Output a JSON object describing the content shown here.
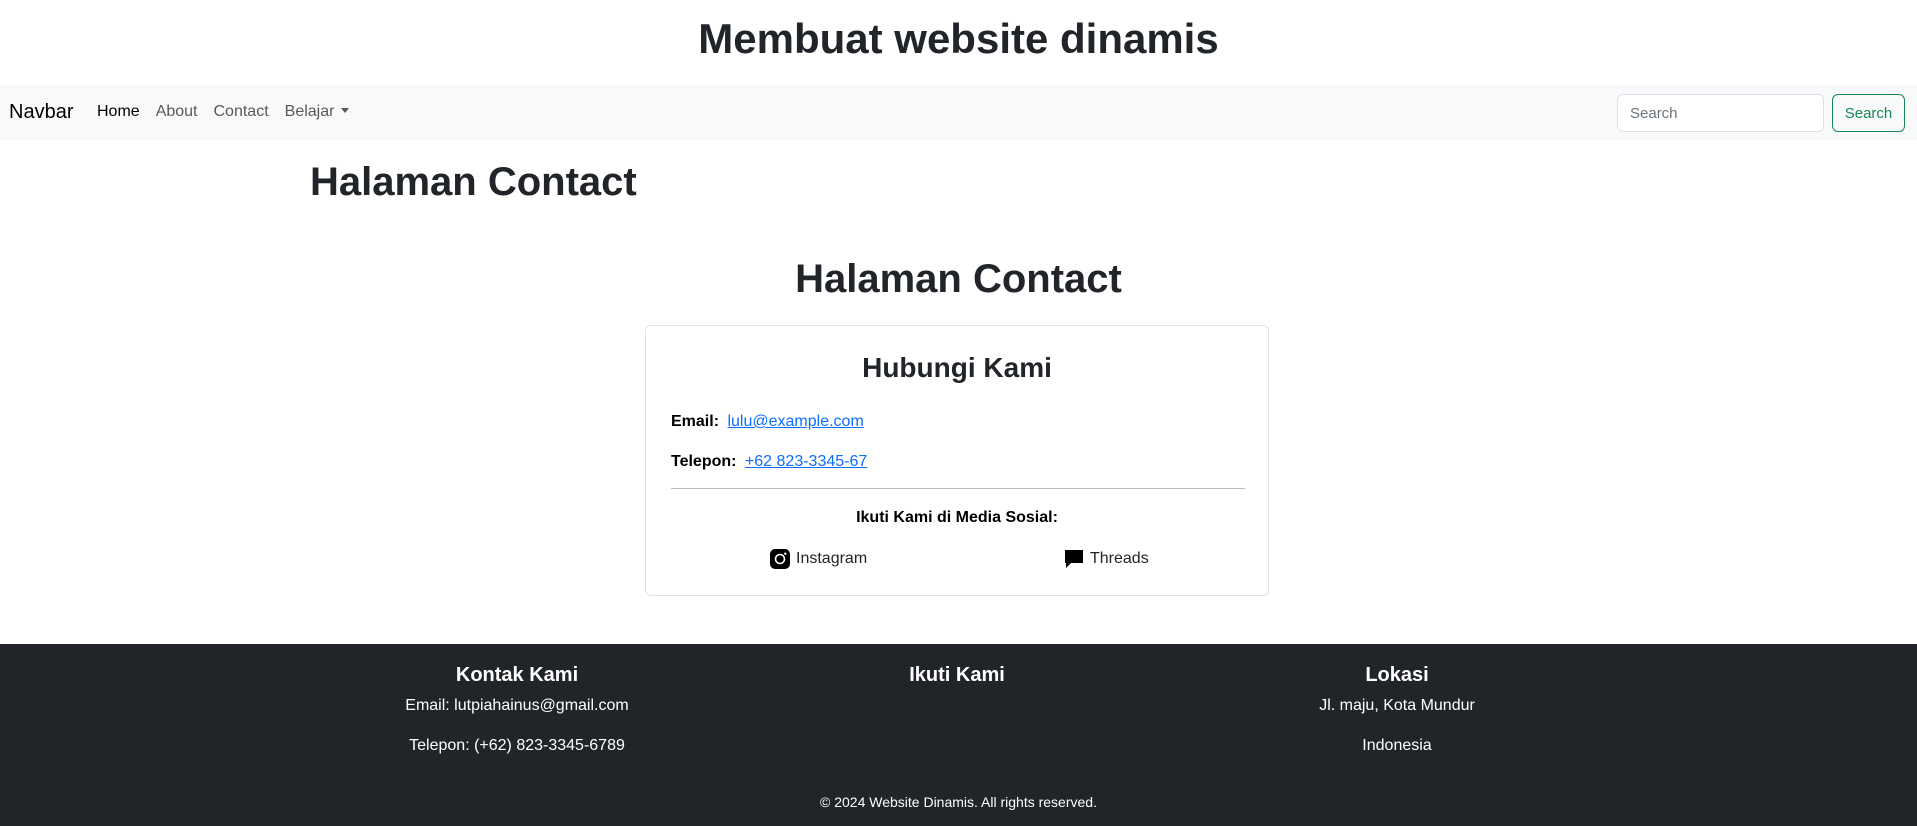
{
  "site": {
    "title": "Membuat website dinamis"
  },
  "navbar": {
    "brand": "Navbar",
    "links": [
      {
        "label": "Home"
      },
      {
        "label": "About"
      },
      {
        "label": "Contact"
      },
      {
        "label": "Belajar"
      }
    ],
    "search_placeholder": "Search",
    "search_button": "Search"
  },
  "main": {
    "page_heading": "Halaman Contact",
    "section_heading": "Halaman Contact",
    "card": {
      "title": "Hubungi Kami",
      "email_label": "Email:",
      "email": "lulu@example.com",
      "phone_label": "Telepon:",
      "phone": "+62 823-3345-67",
      "social_title": "Ikuti Kami di Media Sosial:",
      "social": [
        {
          "label": "Instagram",
          "icon": "instagram-icon"
        },
        {
          "label": "Threads",
          "icon": "chat-bubble-icon"
        }
      ]
    }
  },
  "footer": {
    "contact_heading": "Kontak Kami",
    "contact_email": "Email: lutpiahainus@gmail.com",
    "contact_phone": "Telepon: (+62) 823-3345-6789",
    "follow_heading": "Ikuti Kami",
    "location_heading": "Lokasi",
    "location_address": "Jl. maju, Kota Mundur",
    "location_country": "Indonesia",
    "copyright": "© 2024 Website Dinamis. All rights reserved."
  },
  "colors": {
    "navbar_bg": "#f8f9fa",
    "footer_bg": "#212529",
    "link": "#0d6efd",
    "search_button": "#198754"
  }
}
